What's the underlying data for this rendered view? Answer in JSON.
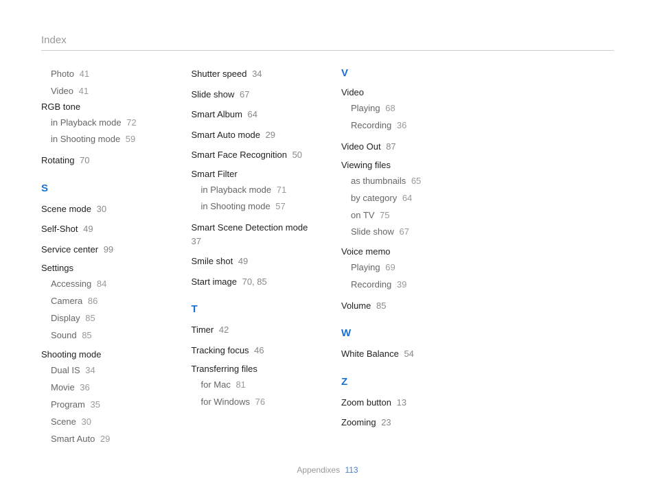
{
  "header": "Index",
  "footer": {
    "section": "Appendixes",
    "page": "113"
  },
  "columns": [
    [
      {
        "type": "sub",
        "label": "Photo",
        "pages": "41"
      },
      {
        "type": "sub",
        "label": "Video",
        "pages": "41"
      },
      {
        "type": "group",
        "label": "RGB tone",
        "subs": [
          {
            "label": "in Playback mode",
            "pages": "72"
          },
          {
            "label": "in Shooting mode",
            "pages": "59"
          }
        ]
      },
      {
        "type": "entry",
        "label": "Rotating",
        "pages": "70"
      },
      {
        "type": "letter",
        "label": "S"
      },
      {
        "type": "entry",
        "label": "Scene mode",
        "pages": "30"
      },
      {
        "type": "entry",
        "label": "Self-Shot",
        "pages": "49"
      },
      {
        "type": "entry",
        "label": "Service center",
        "pages": "99"
      },
      {
        "type": "group",
        "label": "Settings",
        "subs": [
          {
            "label": "Accessing",
            "pages": "84"
          },
          {
            "label": "Camera",
            "pages": "86"
          },
          {
            "label": "Display",
            "pages": "85"
          },
          {
            "label": "Sound",
            "pages": "85"
          }
        ]
      },
      {
        "type": "group",
        "label": "Shooting mode",
        "subs": [
          {
            "label": "Dual IS",
            "pages": "34"
          },
          {
            "label": "Movie",
            "pages": "36"
          },
          {
            "label": "Program",
            "pages": "35"
          },
          {
            "label": "Scene",
            "pages": "30"
          },
          {
            "label": "Smart Auto",
            "pages": "29"
          }
        ]
      }
    ],
    [
      {
        "type": "entry",
        "label": "Shutter speed",
        "pages": "34"
      },
      {
        "type": "entry",
        "label": "Slide show",
        "pages": "67"
      },
      {
        "type": "entry",
        "label": "Smart Album",
        "pages": "64"
      },
      {
        "type": "entry",
        "label": "Smart Auto mode",
        "pages": "29"
      },
      {
        "type": "entry",
        "label": "Smart Face Recognition",
        "pages": "50"
      },
      {
        "type": "group",
        "label": "Smart Filter",
        "subs": [
          {
            "label": "in Playback mode",
            "pages": "71"
          },
          {
            "label": "in Shooting mode",
            "pages": "57"
          }
        ]
      },
      {
        "type": "entry",
        "label": "Smart Scene Detection mode",
        "pages": "37"
      },
      {
        "type": "entry",
        "label": "Smile shot",
        "pages": "49"
      },
      {
        "type": "entry",
        "label": "Start image",
        "pages": "70, 85"
      },
      {
        "type": "letter",
        "label": "T"
      },
      {
        "type": "entry",
        "label": "Timer",
        "pages": "42"
      },
      {
        "type": "entry",
        "label": "Tracking focus",
        "pages": "46"
      },
      {
        "type": "group",
        "label": "Transferring files",
        "subs": [
          {
            "label": "for Mac",
            "pages": "81"
          },
          {
            "label": "for Windows",
            "pages": "76"
          }
        ]
      }
    ],
    [
      {
        "type": "letter-top",
        "label": "V"
      },
      {
        "type": "group",
        "label": "Video",
        "subs": [
          {
            "label": "Playing",
            "pages": "68"
          },
          {
            "label": "Recording",
            "pages": "36"
          }
        ]
      },
      {
        "type": "entry",
        "label": "Video Out",
        "pages": "87"
      },
      {
        "type": "group",
        "label": "Viewing files",
        "subs": [
          {
            "label": "as thumbnails",
            "pages": "65"
          },
          {
            "label": "by category",
            "pages": "64"
          },
          {
            "label": "on TV",
            "pages": "75"
          },
          {
            "label": "Slide show",
            "pages": "67"
          }
        ]
      },
      {
        "type": "group",
        "label": "Voice memo",
        "subs": [
          {
            "label": "Playing",
            "pages": "69"
          },
          {
            "label": "Recording",
            "pages": "39"
          }
        ]
      },
      {
        "type": "entry",
        "label": "Volume",
        "pages": "85"
      },
      {
        "type": "letter",
        "label": "W"
      },
      {
        "type": "entry",
        "label": "White Balance",
        "pages": "54"
      },
      {
        "type": "letter",
        "label": "Z"
      },
      {
        "type": "entry",
        "label": "Zoom button",
        "pages": "13"
      },
      {
        "type": "entry",
        "label": "Zooming",
        "pages": "23"
      }
    ],
    []
  ]
}
